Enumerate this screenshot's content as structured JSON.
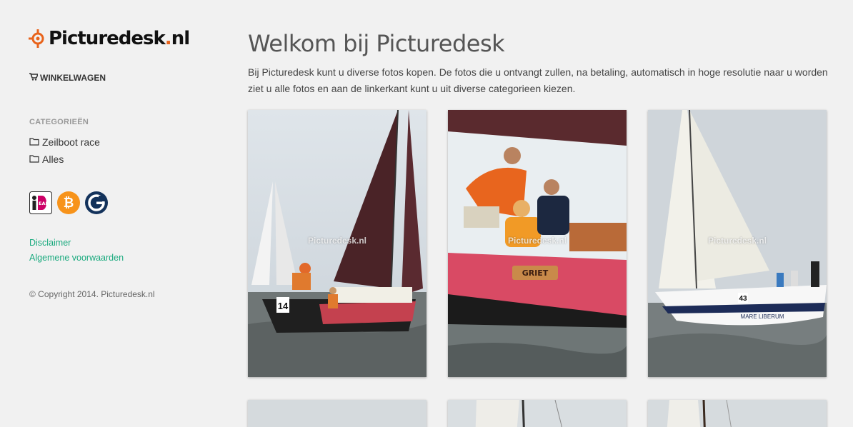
{
  "brand": {
    "logo_text": "Picturedesk",
    "logo_tld": "nl",
    "logo_dot": ".",
    "accent": "#e8631b"
  },
  "sidebar": {
    "cart_icon": "shopping-cart-icon",
    "cart_label": "WINKELWAGEN",
    "categories_heading": "CATEGORIEËN",
    "categories": [
      {
        "label": "Zeilboot race",
        "icon": "folder-icon"
      },
      {
        "label": "Alles",
        "icon": "folder-icon"
      }
    ],
    "payment_icons": [
      "ideal-icon",
      "bitcoin-icon",
      "gocoin-icon"
    ],
    "links": {
      "disclaimer": "Disclaimer",
      "terms": "Algemene voorwaarden"
    },
    "copyright": "© Copyright 2014. Picturedesk.nl",
    "link_color": "#1aaa7e"
  },
  "main": {
    "title": "Welkom bij Picturedesk",
    "intro_line1": "Bij Picturedesk kunt u diverse fotos kopen. De fotos die u ontvangt zullen, na betaling, automatisch in hoge resolutie naar u worden",
    "intro_line2": "ziet u alle fotos en aan de linkerkant kunt u uit diverse categorieen kiezen.",
    "watermark": "Picturedesk.nl",
    "photos": [
      {
        "subject": "Sailboat with dark red sails, sail number 14"
      },
      {
        "subject": "Crew in orange shirts on boat GRIET"
      },
      {
        "subject": "White sailboat MARE LIBERUM, sail number 43"
      },
      {
        "subject": "Sailboat photo (partially visible)"
      },
      {
        "subject": "Sailboat photo (partially visible)"
      },
      {
        "subject": "Sailboat photo (partially visible)"
      }
    ],
    "boat_name_1": "14",
    "boat_name_2": "GRIET",
    "boat_name_3": "MARE LIBERUM",
    "sail_number_3": "43"
  }
}
